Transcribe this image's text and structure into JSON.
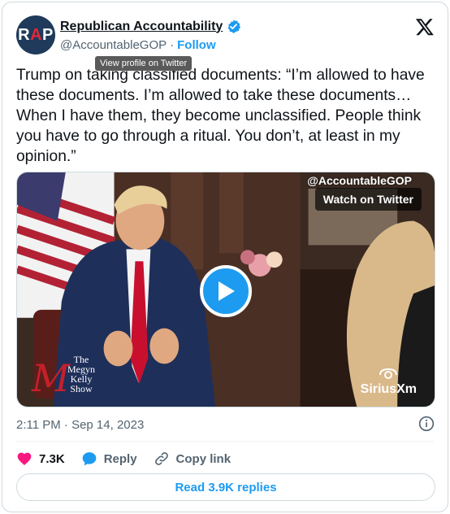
{
  "author": {
    "display_name": "Republican Accountability",
    "handle": "@AccountableGOP",
    "separator": "·",
    "follow_label": "Follow",
    "avatar_text_r": "R",
    "avatar_text_a": "A",
    "avatar_text_p": "P"
  },
  "tooltip": "View profile on Twitter",
  "tweet": {
    "text": "Trump on taking classified documents: “I’m allowed to have these documents. I’m allowed to take these documents… When I have them, they become unclassified. People think you have to go through a ritual. You don’t, at least in my opinion.”"
  },
  "media": {
    "watermark_handle": "@AccountableGOP",
    "watch_label": "Watch on Twitter",
    "show_logo_letter": "M",
    "show_logo_text": "The\nMegyn\nKelly\nShow",
    "sirius_label": "SiriusXm"
  },
  "meta": {
    "timestamp": "2:11 PM · Sep 14, 2023"
  },
  "actions": {
    "like_count": "7.3K",
    "reply_label": "Reply",
    "copy_label": "Copy link"
  },
  "read_replies_label": "Read 3.9K replies",
  "colors": {
    "accent": "#1d9bf0",
    "like": "#f91880",
    "muted": "#536471"
  },
  "icons": [
    "verified-badge-icon",
    "x-logo-icon",
    "play-icon",
    "info-icon",
    "heart-icon",
    "reply-bubble-icon",
    "link-icon"
  ]
}
